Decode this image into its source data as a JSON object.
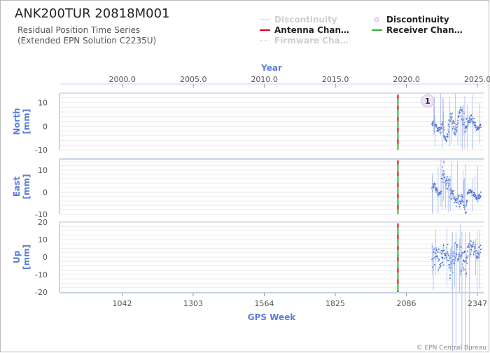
{
  "header": {
    "title": "ANK200TUR 20818M001",
    "subtitle_lines": [
      "Residual Position Time Series",
      "(Extended EPN Solution C2235U)"
    ]
  },
  "legend": {
    "items": [
      {
        "label": "Discontinuity",
        "kind": "line",
        "color": "#e6e6e6",
        "dash": false,
        "faded": true
      },
      {
        "label": "Discontinuity",
        "kind": "dot",
        "color": "#d9b8e8",
        "dash": false,
        "faded": false
      },
      {
        "label": "Antenna Chan…",
        "kind": "line",
        "color": "#d9001b",
        "dash": false,
        "faded": false
      },
      {
        "label": "Receiver Chan…",
        "kind": "line",
        "color": "#33b233",
        "dash": false,
        "faded": false
      },
      {
        "label": "Firmware Cha…",
        "kind": "line",
        "color": "#e6e6e6",
        "dash": true,
        "faded": true
      }
    ]
  },
  "credit": "© EPN Central Bureau",
  "chart_data": {
    "type": "scatter",
    "x_top": {
      "title": "Year",
      "ticks": [
        "2000.0",
        "2005.0",
        "2010.0",
        "2015.0",
        "2020.0",
        "2025.0"
      ]
    },
    "x_bottom": {
      "title": "GPS Week",
      "ticks": [
        1042,
        1303,
        1564,
        1825,
        2086,
        2347
      ],
      "range": [
        812,
        2370
      ]
    },
    "antenna_change_week": 2055,
    "receiver_change_week": 2055,
    "discontinuity_marker": {
      "week": 2164,
      "label": "1",
      "panel": "North"
    },
    "panels": [
      {
        "name": "North",
        "ylabel": [
          "North",
          "[mm]"
        ],
        "ylim": [
          -10,
          14
        ],
        "yticks": [
          "10",
          "0",
          "-10"
        ],
        "ytick_values": [
          10,
          0,
          -10
        ],
        "series": [
          {
            "from": 2180,
            "to": 2210,
            "mean": 0,
            "amp": 1.5,
            "noise": 1.2
          },
          {
            "from": 2210,
            "to": 2240,
            "mean": -3,
            "amp": 3,
            "noise": 1.6
          },
          {
            "from": 2240,
            "to": 2275,
            "mean": 1,
            "amp": 3,
            "noise": 2.5
          },
          {
            "from": 2275,
            "to": 2310,
            "mean": 3,
            "amp": 3,
            "noise": 3.0
          },
          {
            "from": 2310,
            "to": 2360,
            "mean": 1,
            "amp": 2,
            "noise": 1.2
          }
        ]
      },
      {
        "name": "East",
        "ylabel": [
          "East",
          "[mm]"
        ],
        "ylim": [
          -10,
          15
        ],
        "yticks": [
          "10",
          "0",
          "-10"
        ],
        "ytick_values": [
          10,
          0,
          -10
        ],
        "series": [
          {
            "from": 2180,
            "to": 2215,
            "mean": 1,
            "amp": 2,
            "noise": 1.2
          },
          {
            "from": 2215,
            "to": 2245,
            "mean": 6,
            "amp": 3,
            "noise": 2.8
          },
          {
            "from": 2245,
            "to": 2280,
            "mean": -2,
            "amp": 2,
            "noise": 1.5
          },
          {
            "from": 2280,
            "to": 2310,
            "mean": -5,
            "amp": 2,
            "noise": 2.2
          },
          {
            "from": 2310,
            "to": 2360,
            "mean": -1,
            "amp": 1.5,
            "noise": 1.0
          }
        ]
      },
      {
        "name": "Up",
        "ylabel": [
          "Up",
          "[mm]"
        ],
        "ylim": [
          -20,
          20
        ],
        "yticks": [
          "20",
          "10",
          "0",
          "-10",
          "-20"
        ],
        "ytick_values": [
          20,
          10,
          0,
          -10,
          -20
        ],
        "series": [
          {
            "from": 2180,
            "to": 2220,
            "mean": 0,
            "amp": 2,
            "noise": 4.5
          },
          {
            "from": 2220,
            "to": 2260,
            "mean": -2,
            "amp": 3,
            "noise": 5.5
          },
          {
            "from": 2260,
            "to": 2310,
            "mean": -1,
            "amp": 3,
            "noise": 6.5
          },
          {
            "from": 2310,
            "to": 2360,
            "mean": 4,
            "amp": 2,
            "noise": 3.5
          }
        ]
      }
    ]
  }
}
